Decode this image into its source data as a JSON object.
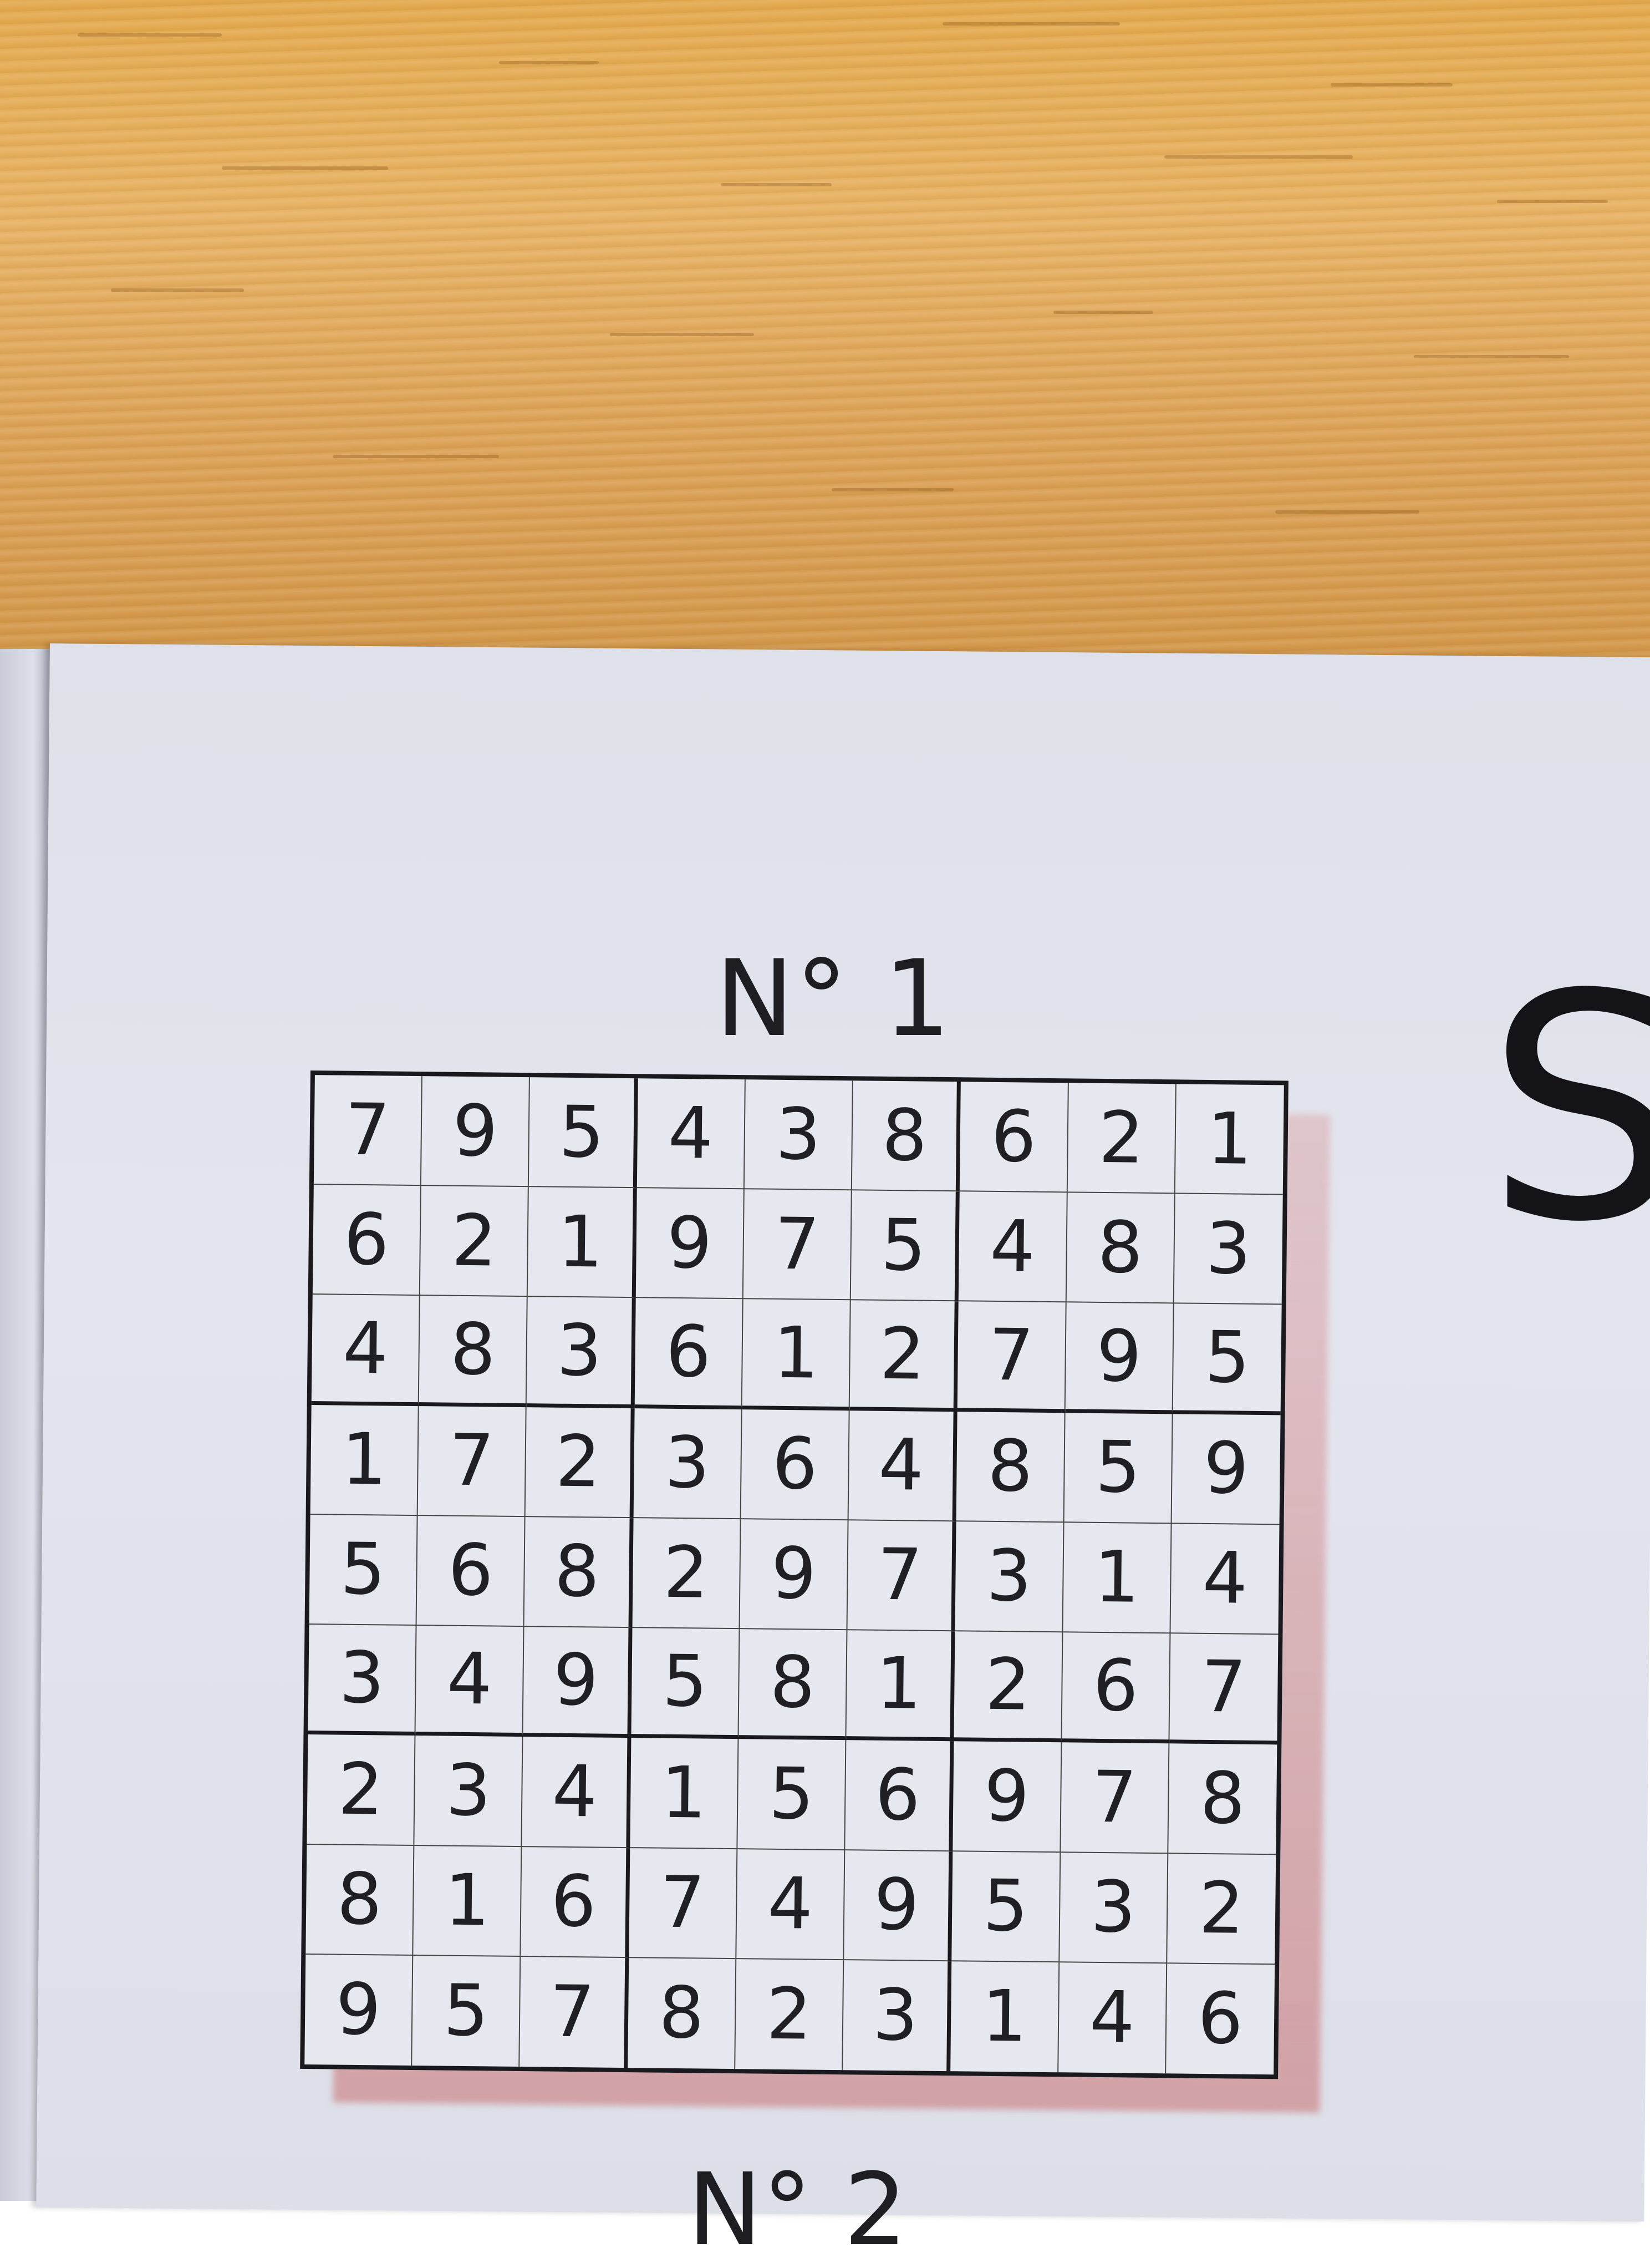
{
  "puzzle": {
    "title": "N° 1",
    "next_label": "N° 2",
    "side_letter": "S",
    "grid": [
      [
        "7",
        "9",
        "5",
        "4",
        "3",
        "8",
        "6",
        "2",
        "1"
      ],
      [
        "6",
        "2",
        "1",
        "9",
        "7",
        "5",
        "4",
        "8",
        "3"
      ],
      [
        "4",
        "8",
        "3",
        "6",
        "1",
        "2",
        "7",
        "9",
        "5"
      ],
      [
        "1",
        "7",
        "2",
        "3",
        "6",
        "4",
        "8",
        "5",
        "9"
      ],
      [
        "5",
        "6",
        "8",
        "2",
        "9",
        "7",
        "3",
        "1",
        "4"
      ],
      [
        "3",
        "4",
        "9",
        "5",
        "8",
        "1",
        "2",
        "6",
        "7"
      ],
      [
        "2",
        "3",
        "4",
        "1",
        "5",
        "6",
        "9",
        "7",
        "8"
      ],
      [
        "8",
        "1",
        "6",
        "7",
        "4",
        "9",
        "5",
        "3",
        "2"
      ],
      [
        "9",
        "5",
        "7",
        "8",
        "2",
        "3",
        "1",
        "4",
        "6"
      ]
    ]
  }
}
